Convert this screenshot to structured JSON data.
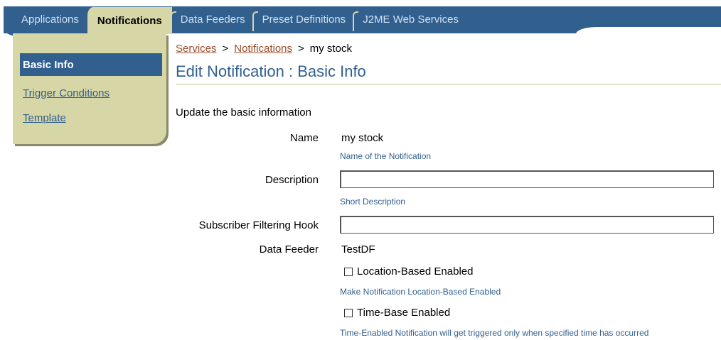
{
  "tabs": [
    {
      "label": "Applications",
      "active": false
    },
    {
      "label": "Notifications",
      "active": true
    },
    {
      "label": "Data Feeders",
      "active": false
    },
    {
      "label": "Preset Definitions",
      "active": false
    },
    {
      "label": "J2ME Web Services",
      "active": false
    }
  ],
  "sidebar": {
    "items": [
      {
        "label": "Basic Info",
        "selected": true
      },
      {
        "label": "Trigger Conditions",
        "selected": false
      },
      {
        "label": "Template",
        "selected": false
      }
    ]
  },
  "breadcrumb": {
    "items": [
      "Services",
      "Notifications",
      "my stock"
    ],
    "separator": ">"
  },
  "page_title": "Edit Notification : Basic Info",
  "intro": "Update the basic information",
  "form": {
    "name": {
      "label": "Name",
      "value": "my stock",
      "hint": "Name of the Notification"
    },
    "description": {
      "label": "Description",
      "value": "",
      "hint": "Short Description"
    },
    "subscriber_hook": {
      "label": "Subscriber Filtering Hook",
      "value": ""
    },
    "data_feeder": {
      "label": "Data Feeder",
      "value": "TestDF"
    },
    "location_based": {
      "label": "Location-Based Enabled",
      "checked": false,
      "hint": "Make Notification Location-Based Enabled"
    },
    "time_based": {
      "label": "Time-Base Enabled",
      "checked": false,
      "hint": "Time-Enabled Notification will get triggered only when specified time has occurred"
    }
  },
  "colors": {
    "tab_bar": "#31608f",
    "accent_khaki": "#d7d6a6",
    "title_blue": "#31608f",
    "link_brown": "#9c4d29"
  }
}
